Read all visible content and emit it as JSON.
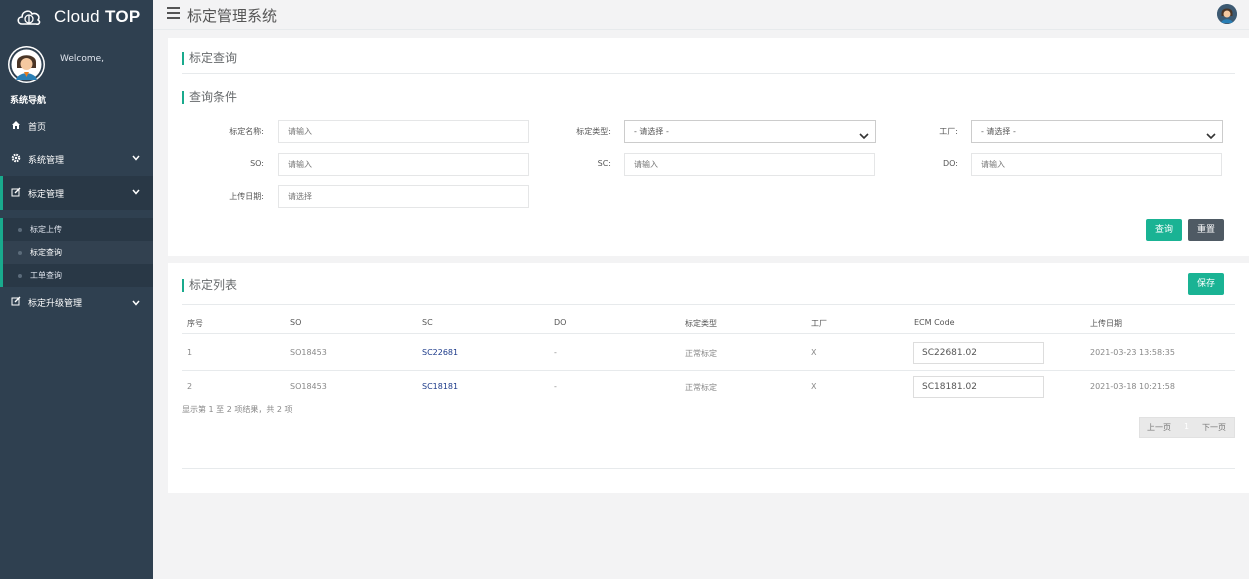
{
  "sidebar": {
    "brand": {
      "name_light": "Cloud",
      "name_bold": "TOP"
    },
    "welcome": "Welcome,",
    "nav_title": "系统导航",
    "items": [
      {
        "label": "首页",
        "icon": "home-icon"
      },
      {
        "label": "系统管理",
        "icon": "gear-icon"
      },
      {
        "label": "标定管理",
        "icon": "edit-icon"
      },
      {
        "label": "标定升级管理",
        "icon": "edit-icon"
      }
    ],
    "subitems": [
      {
        "label": "标定上传"
      },
      {
        "label": "标定查询"
      },
      {
        "label": "工单查询"
      }
    ]
  },
  "topbar": {
    "title": "标定管理系统"
  },
  "query_panel": {
    "title": "标定查询",
    "conditions_title": "查询条件",
    "fields": {
      "name_label": "标定名称:",
      "name_placeholder": "请输入",
      "type_label": "标定类型:",
      "type_value": "- 请选择 -",
      "factory_label": "工厂:",
      "factory_value": "- 请选择 -",
      "so_label": "SO:",
      "so_placeholder": "请输入",
      "sc_label": "SC:",
      "sc_placeholder": "请输入",
      "do_label": "DO:",
      "do_placeholder": "请输入",
      "date_label": "上传日期:",
      "date_placeholder": "请选择"
    },
    "buttons": {
      "search": "查询",
      "reset": "重置"
    }
  },
  "list_panel": {
    "title": "标定列表",
    "save": "保存",
    "headers": [
      "序号",
      "SO",
      "SC",
      "DO",
      "标定类型",
      "工厂",
      "ECM Code",
      "上传日期"
    ],
    "rows": [
      {
        "no": "1",
        "so": "SO18453",
        "sc": "SC22681",
        "do": "-",
        "type": "正常标定",
        "factory": "X",
        "ecm": "SC22681.02",
        "date": "2021-03-23 13:58:35"
      },
      {
        "no": "2",
        "so": "SO18453",
        "sc": "SC18181",
        "do": "-",
        "type": "正常标定",
        "factory": "X",
        "ecm": "SC18181.02",
        "date": "2021-03-18 10:21:58"
      }
    ],
    "summary": "显示第 1 至 2 项结果，共 2 项",
    "pager": {
      "prev": "上一页",
      "page": "1",
      "next": "下一页"
    }
  },
  "colors": {
    "sidebar_bg": "#2f4050",
    "accent": "#1ab394",
    "gray_button": "#4f5a64",
    "link": "#1c3a8a"
  }
}
